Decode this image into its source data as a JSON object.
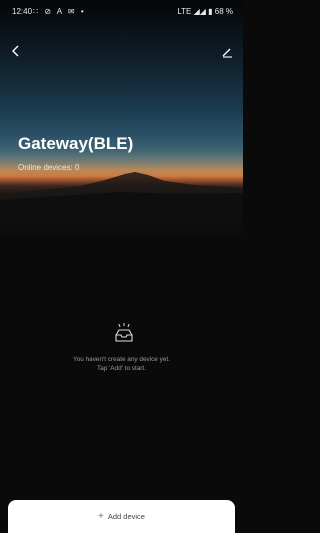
{
  "status_bar": {
    "time": "12:40",
    "left_icons": "∷ ⊘ A ✉ •",
    "right_text": "LTE ◢◢ ▮ 68 %"
  },
  "header": {
    "back_icon": "back-chevron-icon",
    "edit_icon": "edit-pencil-icon"
  },
  "gateway": {
    "title": "Gateway(BLE)",
    "online_devices": "Online devices: 0"
  },
  "empty_state": {
    "icon": "empty-inbox-icon",
    "line1": "You haven't create any device yet.",
    "line2": "Tap 'Add' to start."
  },
  "footer": {
    "add_icon": "plus-icon",
    "add_label": "Add device"
  }
}
